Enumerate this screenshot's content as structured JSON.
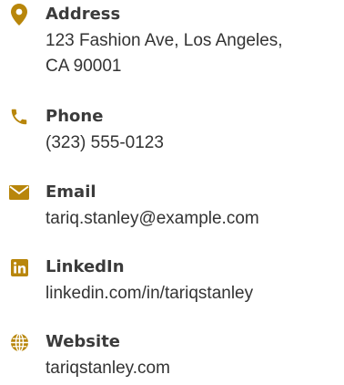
{
  "colors": {
    "accent": "#b8860b",
    "label": "#3b3b3b",
    "text": "#333333"
  },
  "contacts": [
    {
      "icon": "map-pin-icon",
      "label": "Address",
      "lines": [
        "123 Fashion Ave, Los Angeles,",
        "CA 90001"
      ]
    },
    {
      "icon": "phone-icon",
      "label": "Phone",
      "lines": [
        "(323) 555-0123"
      ]
    },
    {
      "icon": "envelope-icon",
      "label": "Email",
      "lines": [
        "tariq.stanley@example.com"
      ]
    },
    {
      "icon": "linkedin-icon",
      "label": "LinkedIn",
      "lines": [
        "linkedin.com/in/tariqstanley"
      ]
    },
    {
      "icon": "globe-icon",
      "label": "Website",
      "lines": [
        "tariqstanley.com"
      ]
    }
  ]
}
